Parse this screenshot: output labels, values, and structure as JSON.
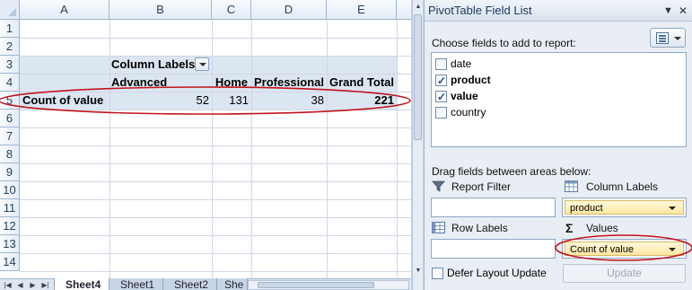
{
  "sheet": {
    "columns": [
      "A",
      "B",
      "C",
      "D",
      "E"
    ],
    "rows": [
      "1",
      "2",
      "3",
      "4",
      "5",
      "6",
      "7",
      "8",
      "9",
      "10",
      "11",
      "12",
      "13",
      "14"
    ],
    "pivot": {
      "column_labels_caption": "Column Labels",
      "headers": [
        "Advanced",
        "Home",
        "Professional",
        "Grand Total"
      ],
      "row_label": "Count of value",
      "values": [
        "52",
        "131",
        "38",
        "221"
      ]
    },
    "tabs": [
      "Sheet4",
      "Sheet1",
      "Sheet2",
      "She"
    ],
    "active_tab": "Sheet4"
  },
  "pane": {
    "title": "PivotTable Field List",
    "title_dropdown_glyph": "▼",
    "close_glyph": "✕",
    "choose_label": "Choose fields to add to report:",
    "fields": [
      {
        "name": "date",
        "checked": false
      },
      {
        "name": "product",
        "checked": true
      },
      {
        "name": "value",
        "checked": true
      },
      {
        "name": "country",
        "checked": false
      }
    ],
    "drag_label": "Drag fields between areas below:",
    "areas": {
      "report_filter": {
        "label": "Report Filter",
        "items": []
      },
      "column_labels": {
        "label": "Column Labels",
        "items": [
          "product"
        ]
      },
      "row_labels": {
        "label": "Row Labels",
        "items": []
      },
      "values": {
        "label": "Values",
        "items": [
          "Count of value"
        ]
      }
    },
    "defer_label": "Defer Layout Update",
    "update_label": "Update"
  },
  "colors": {
    "header_text": "#27415f",
    "pivot_band": "#dce6f1",
    "annotation": "#c0141b",
    "chip": "#ffe7a2"
  }
}
